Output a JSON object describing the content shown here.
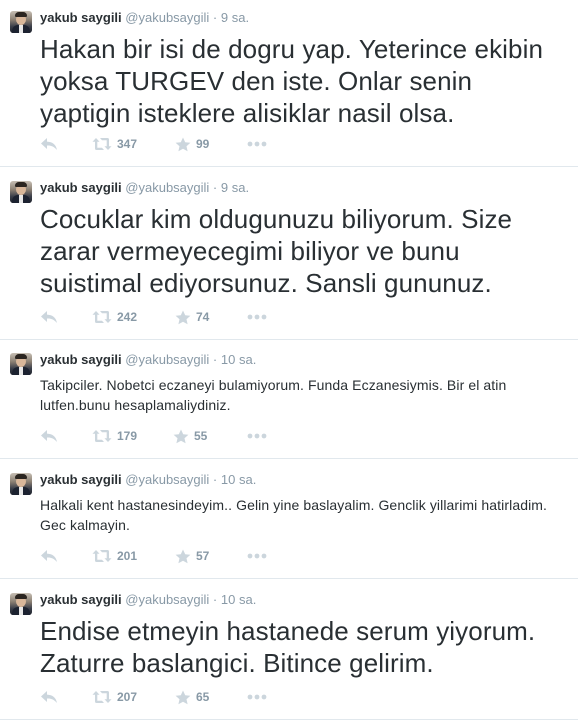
{
  "tweets": [
    {
      "fullname": "yakub saygili",
      "username": "@yakubsaygili",
      "separator": "·",
      "time": "9 sa.",
      "text": "Hakan bir isi de dogru yap. Yeterince ekibin yoksa TURGEV den iste. Onlar senin yaptigin isteklere alisiklar nasil olsa.",
      "retweets": "347",
      "favorites": "99"
    },
    {
      "fullname": "yakub saygili",
      "username": "@yakubsaygili",
      "separator": "·",
      "time": "9 sa.",
      "text": "Cocuklar kim oldugunuzu biliyorum.  Size zarar vermeyecegimi biliyor ve bunu suistimal ediyorsunuz. Sansli gununuz.",
      "retweets": "242",
      "favorites": "74"
    },
    {
      "fullname": "yakub saygili",
      "username": "@yakubsaygili",
      "separator": "·",
      "time": "10 sa.",
      "text": "Takipciler. Nobetci eczaneyi bulamiyorum. Funda Eczanesiymis. Bir el atin lutfen.bunu hesaplamaliydiniz.",
      "retweets": "179",
      "favorites": "55"
    },
    {
      "fullname": "yakub saygili",
      "username": "@yakubsaygili",
      "separator": "·",
      "time": "10 sa.",
      "text": "Halkali kent hastanesindeyim.. Gelin yine baslayalim. Genclik yillarimi hatirladim. Gec kalmayin.",
      "retweets": "201",
      "favorites": "57"
    },
    {
      "fullname": "yakub saygili",
      "username": "@yakubsaygili",
      "separator": "·",
      "time": "10 sa.",
      "text": "Endise etmeyin hastanede serum yiyorum. Zaturre baslangici. Bitince gelirim.",
      "retweets": "207",
      "favorites": "65"
    }
  ],
  "icons": {
    "reply": "reply-icon",
    "retweet": "retweet-icon",
    "favorite": "star-icon",
    "more": "more-icon"
  },
  "colors": {
    "text": "#292f33",
    "muted": "#8899a6",
    "icon": "#ccd6dd",
    "divider": "#e1e8ed"
  }
}
